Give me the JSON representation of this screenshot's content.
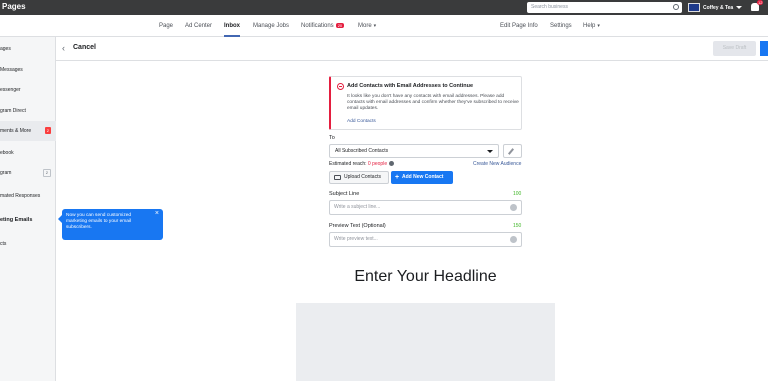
{
  "topbar": {
    "brand": "Pages",
    "search_placeholder": "Search business",
    "page_name": "Coffey & Tea",
    "notif_count": "12"
  },
  "pagenav": {
    "tabs": [
      {
        "label": "Page"
      },
      {
        "label": "Ad Center"
      },
      {
        "label": "Inbox"
      },
      {
        "label": "Manage Jobs"
      },
      {
        "label": "Notifications"
      },
      {
        "label": "More"
      }
    ],
    "notif_badge": "20",
    "right": [
      {
        "label": "Edit Page Info"
      },
      {
        "label": "Settings"
      },
      {
        "label": "Help"
      }
    ]
  },
  "sidebar": {
    "items": [
      {
        "label": "ages"
      },
      {
        "label": "Messages"
      },
      {
        "label": "essenger"
      },
      {
        "label": "gram Direct"
      },
      {
        "label": "ments & More",
        "badge": "2"
      },
      {
        "label": "ebook"
      },
      {
        "label": "gram",
        "count": "2"
      },
      {
        "label": "mated Responses"
      },
      {
        "label": "eting Emails"
      },
      {
        "label": "cts"
      }
    ]
  },
  "header": {
    "cancel": "Cancel",
    "save_draft": "Save Draft"
  },
  "alert": {
    "title": "Add Contacts with Email Addresses to Continue",
    "body": "It looks like you don't have any contacts with email addresses. Please add contacts with email addresses and confirm whether they've subscribed to receive email updates.",
    "link": "Add Contacts"
  },
  "form": {
    "to_label": "To",
    "to_value": "All Subscribed Contacts",
    "reach_label": "Estimated reach:",
    "reach_value": "0 people",
    "create_audience": "Create New Audience",
    "upload_label": "Upload Contacts",
    "add_label": "Add New Contact",
    "subject_label": "Subject Line",
    "subject_counter": "100",
    "subject_placeholder": "Write a subject line...",
    "preview_label": "Preview Text (Optional)",
    "preview_counter": "150",
    "preview_placeholder": "Write preview text..."
  },
  "headline": "Enter Your Headline",
  "tooltip": {
    "text": "Now you can send customized marketing emails to your email subscribers.",
    "close": "×"
  }
}
